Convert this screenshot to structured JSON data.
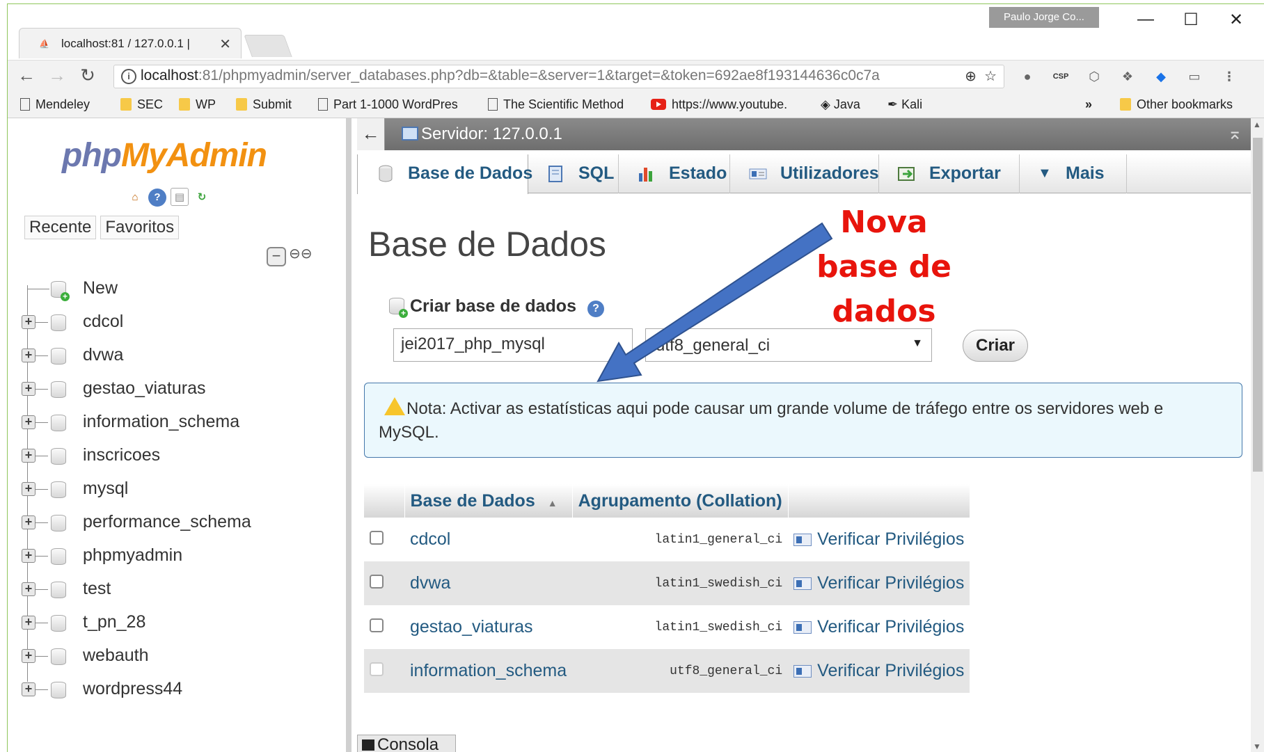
{
  "browser": {
    "tab_title": "localhost:81 / 127.0.0.1 | ",
    "profile_name": "Paulo Jorge Co...",
    "url_host": "localhost",
    "url_rest": ":81/phpmyadmin/server_databases.php?db=&table=&server=1&target=&token=692ae8f193144636c0c7a",
    "bookmarks": [
      "Mendeley",
      "SEC",
      "WP",
      "Submit",
      "Part 1-1000 WordPres",
      "The Scientific Method",
      "https://www.youtube.",
      "Java",
      "Kali"
    ],
    "more_bookmarks": "»",
    "other_bookmarks": "Other bookmarks"
  },
  "nav": {
    "logo_php": "php",
    "logo_myadmin": "MyAdmin",
    "recent": "Recente",
    "favorites": "Favoritos",
    "new_item": "New",
    "databases": [
      "cdcol",
      "dvwa",
      "gestao_viaturas",
      "information_schema",
      "inscricoes",
      "mysql",
      "performance_schema",
      "phpmyadmin",
      "test",
      "t_pn_28",
      "webauth",
      "wordpress44"
    ]
  },
  "main": {
    "server_label": "Servidor: 127.0.0.1",
    "tabs": {
      "databases": "Base de Dados",
      "sql": "SQL",
      "status": "Estado",
      "users": "Utilizadores",
      "export": "Exportar",
      "more": "Mais"
    },
    "page_title": "Base de Dados",
    "create_heading": "Criar base de dados",
    "db_name_value": "jei2017_php_mysql",
    "collation_value": "utf8_general_ci",
    "create_button": "Criar",
    "notice": "Nota: Activar as estatísticas aqui pode causar um grande volume de tráfego entre os servidores web e MySQL.",
    "table_headers": {
      "database": "Base de Dados",
      "collation": "Agrupamento (Collation)"
    },
    "rows": [
      {
        "name": "cdcol",
        "collation": "latin1_general_ci",
        "action": "Verificar Privilégios"
      },
      {
        "name": "dvwa",
        "collation": "latin1_swedish_ci",
        "action": "Verificar Privilégios"
      },
      {
        "name": "gestao_viaturas",
        "collation": "latin1_swedish_ci",
        "action": "Verificar Privilégios"
      },
      {
        "name": "information_schema",
        "collation": "utf8_general_ci",
        "action": "Verificar Privilégios"
      }
    ],
    "console": "Consola"
  },
  "annotation": {
    "line1": "Nova",
    "line2": "base de",
    "line3": "dados",
    "color": "#e8140c",
    "arrow_color": "#4472c4"
  }
}
